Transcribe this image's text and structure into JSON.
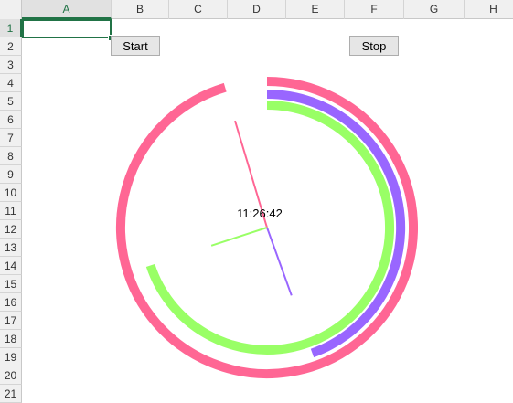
{
  "spreadsheet": {
    "columns": [
      "A",
      "B",
      "C",
      "D",
      "E",
      "F",
      "G",
      "H"
    ],
    "rows": [
      "1",
      "2",
      "3",
      "4",
      "5",
      "6",
      "7",
      "8",
      "9",
      "10",
      "11",
      "12",
      "13",
      "14",
      "15",
      "16",
      "17",
      "18",
      "19",
      "20",
      "21"
    ],
    "active_column": "A",
    "active_row": "1"
  },
  "buttons": {
    "start_label": "Start",
    "stop_label": "Stop"
  },
  "clock": {
    "time_text": "11:26:42",
    "hours": 11,
    "minutes": 26,
    "seconds": 42,
    "colors": {
      "hour": "#ff6694",
      "minute": "#9966ff",
      "second": "#99ff66"
    }
  }
}
